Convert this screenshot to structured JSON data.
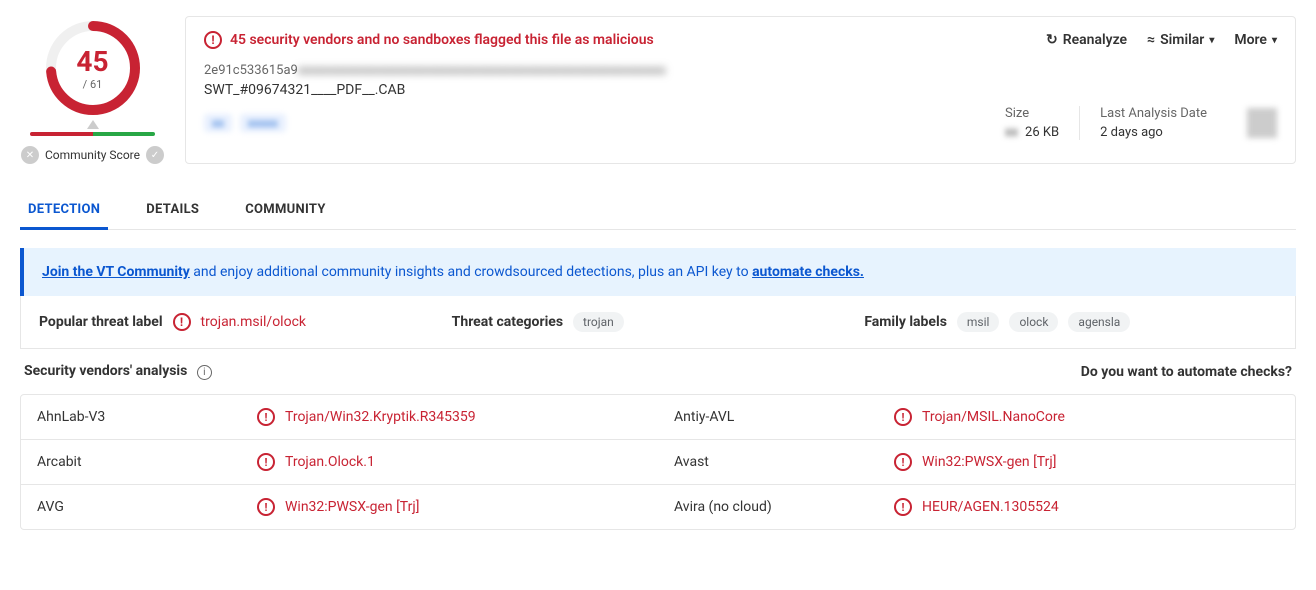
{
  "score": {
    "detections": "45",
    "total": "/ 61"
  },
  "community": {
    "label": "Community Score"
  },
  "alert": {
    "text": "45 security vendors and no sandboxes flagged this file as malicious"
  },
  "actions": {
    "reanalyze": "Reanalyze",
    "similar": "Similar",
    "more": "More"
  },
  "file": {
    "hash_visible": "2e91c533615a9",
    "filename": "SWT_#09674321____PDF__.CAB"
  },
  "meta": {
    "size_label": "Size",
    "size_value": "26 KB",
    "date_label": "Last Analysis Date",
    "date_value": "2 days ago"
  },
  "tabs": {
    "detection": "DETECTION",
    "details": "DETAILS",
    "community": "COMMUNITY"
  },
  "banner": {
    "link1": "Join the VT Community",
    "mid": " and enjoy additional community insights and crowdsourced detections, plus an API key to ",
    "link2": "automate checks."
  },
  "labels": {
    "popular_title": "Popular threat label",
    "popular_value": "trojan.msil/olock",
    "categories_title": "Threat categories",
    "categories": [
      "trojan"
    ],
    "family_title": "Family labels",
    "families": [
      "msil",
      "olock",
      "agensla"
    ]
  },
  "analysis": {
    "title": "Security vendors' analysis",
    "automate": "Do you want to automate checks?"
  },
  "vendors": [
    {
      "left": {
        "name": "AhnLab-V3",
        "verdict": "Trojan/Win32.Kryptik.R345359"
      },
      "right": {
        "name": "Antiy-AVL",
        "verdict": "Trojan/MSIL.NanoCore"
      }
    },
    {
      "left": {
        "name": "Arcabit",
        "verdict": "Trojan.Olock.1"
      },
      "right": {
        "name": "Avast",
        "verdict": "Win32:PWSX-gen [Trj]"
      }
    },
    {
      "left": {
        "name": "AVG",
        "verdict": "Win32:PWSX-gen [Trj]"
      },
      "right": {
        "name": "Avira (no cloud)",
        "verdict": "HEUR/AGEN.1305524"
      }
    }
  ]
}
